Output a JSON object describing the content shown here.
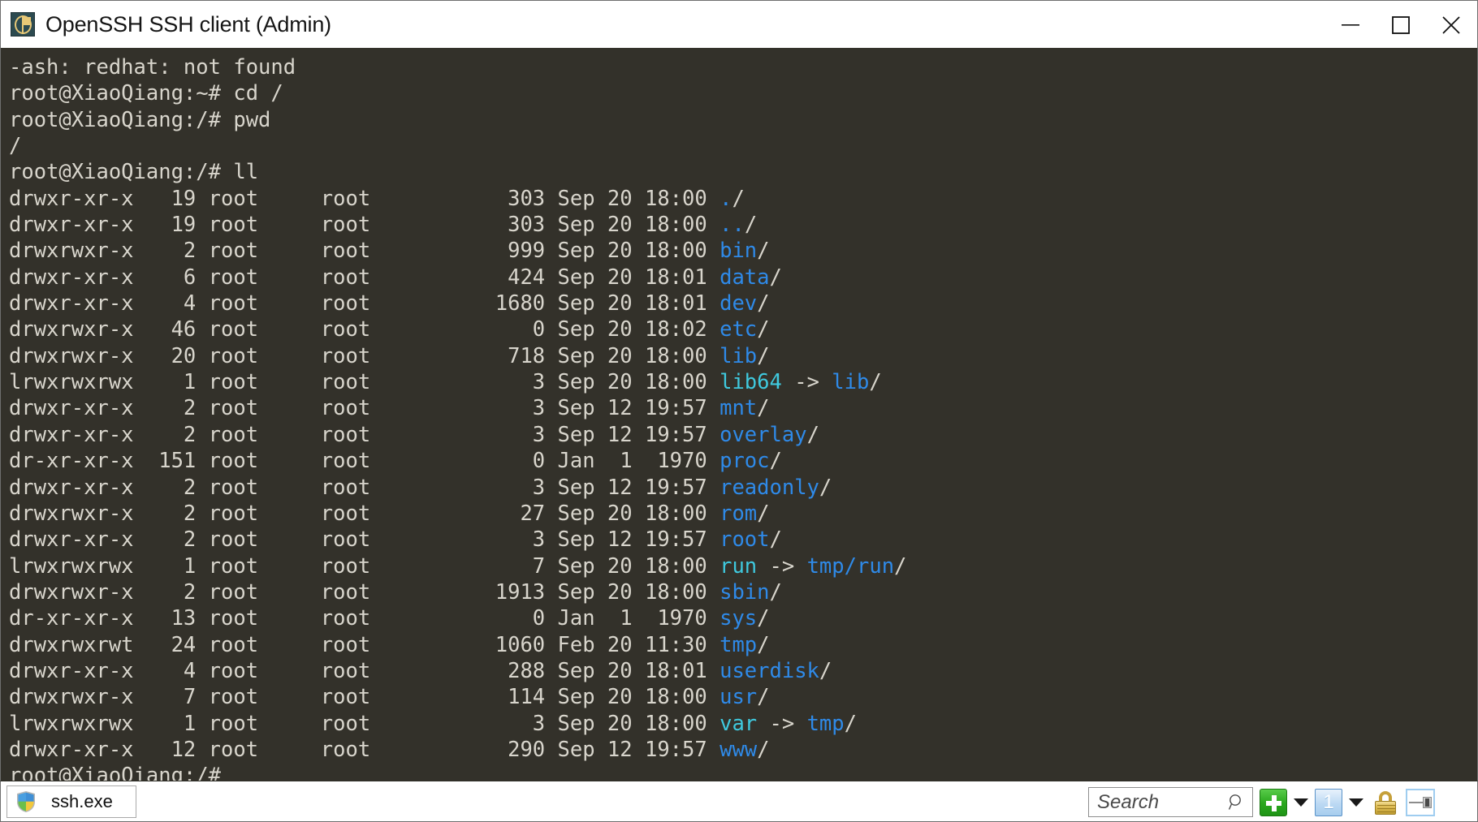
{
  "window": {
    "title": "OpenSSH SSH client (Admin)",
    "icon": "openssh-app-icon",
    "controls": {
      "minimize": "minimize-button",
      "maximize": "maximize-button",
      "close": "close-button"
    }
  },
  "terminal": {
    "background_color": "#33312a",
    "foreground_color": "#d8d5cc",
    "dir_color": "#2f8ae8",
    "link_color": "#3fc9de",
    "lines": [
      {
        "id": "l0",
        "segments": [
          {
            "t": "-ash: redhat: not found",
            "c": "def"
          }
        ]
      },
      {
        "id": "l1",
        "segments": [
          {
            "t": "root@XiaoQiang:~# cd /",
            "c": "def"
          }
        ]
      },
      {
        "id": "l2",
        "segments": [
          {
            "t": "root@XiaoQiang:/# pwd",
            "c": "def"
          }
        ]
      },
      {
        "id": "l3",
        "segments": [
          {
            "t": "/",
            "c": "def"
          }
        ]
      },
      {
        "id": "l4",
        "segments": [
          {
            "t": "root@XiaoQiang:/# ll",
            "c": "def"
          }
        ]
      },
      {
        "id": "l5",
        "segments": [
          {
            "t": "drwxr-xr-x   19 root     root           303 Sep 20 18:00 ",
            "c": "def"
          },
          {
            "t": ".",
            "c": "dir"
          },
          {
            "t": "/",
            "c": "def"
          }
        ]
      },
      {
        "id": "l6",
        "segments": [
          {
            "t": "drwxr-xr-x   19 root     root           303 Sep 20 18:00 ",
            "c": "def"
          },
          {
            "t": "..",
            "c": "dir"
          },
          {
            "t": "/",
            "c": "def"
          }
        ]
      },
      {
        "id": "l7",
        "segments": [
          {
            "t": "drwxrwxr-x    2 root     root           999 Sep 20 18:00 ",
            "c": "def"
          },
          {
            "t": "bin",
            "c": "dir"
          },
          {
            "t": "/",
            "c": "def"
          }
        ]
      },
      {
        "id": "l8",
        "segments": [
          {
            "t": "drwxr-xr-x    6 root     root           424 Sep 20 18:01 ",
            "c": "def"
          },
          {
            "t": "data",
            "c": "dir"
          },
          {
            "t": "/",
            "c": "def"
          }
        ]
      },
      {
        "id": "l9",
        "segments": [
          {
            "t": "drwxr-xr-x    4 root     root          1680 Sep 20 18:01 ",
            "c": "def"
          },
          {
            "t": "dev",
            "c": "dir"
          },
          {
            "t": "/",
            "c": "def"
          }
        ]
      },
      {
        "id": "l10",
        "segments": [
          {
            "t": "drwxrwxr-x   46 root     root             0 Sep 20 18:02 ",
            "c": "def"
          },
          {
            "t": "etc",
            "c": "dir"
          },
          {
            "t": "/",
            "c": "def"
          }
        ]
      },
      {
        "id": "l11",
        "segments": [
          {
            "t": "drwxrwxr-x   20 root     root           718 Sep 20 18:00 ",
            "c": "def"
          },
          {
            "t": "lib",
            "c": "dir"
          },
          {
            "t": "/",
            "c": "def"
          }
        ]
      },
      {
        "id": "l12",
        "segments": [
          {
            "t": "lrwxrwxrwx    1 root     root             3 Sep 20 18:00 ",
            "c": "def"
          },
          {
            "t": "lib64",
            "c": "link"
          },
          {
            "t": " -> ",
            "c": "def"
          },
          {
            "t": "lib",
            "c": "dir"
          },
          {
            "t": "/",
            "c": "def"
          }
        ]
      },
      {
        "id": "l13",
        "segments": [
          {
            "t": "drwxr-xr-x    2 root     root             3 Sep 12 19:57 ",
            "c": "def"
          },
          {
            "t": "mnt",
            "c": "dir"
          },
          {
            "t": "/",
            "c": "def"
          }
        ]
      },
      {
        "id": "l14",
        "segments": [
          {
            "t": "drwxr-xr-x    2 root     root             3 Sep 12 19:57 ",
            "c": "def"
          },
          {
            "t": "overlay",
            "c": "dir"
          },
          {
            "t": "/",
            "c": "def"
          }
        ]
      },
      {
        "id": "l15",
        "segments": [
          {
            "t": "dr-xr-xr-x  151 root     root             0 Jan  1  1970 ",
            "c": "def"
          },
          {
            "t": "proc",
            "c": "dir"
          },
          {
            "t": "/",
            "c": "def"
          }
        ]
      },
      {
        "id": "l16",
        "segments": [
          {
            "t": "drwxr-xr-x    2 root     root             3 Sep 12 19:57 ",
            "c": "def"
          },
          {
            "t": "readonly",
            "c": "dir"
          },
          {
            "t": "/",
            "c": "def"
          }
        ]
      },
      {
        "id": "l17",
        "segments": [
          {
            "t": "drwxrwxr-x    2 root     root            27 Sep 20 18:00 ",
            "c": "def"
          },
          {
            "t": "rom",
            "c": "dir"
          },
          {
            "t": "/",
            "c": "def"
          }
        ]
      },
      {
        "id": "l18",
        "segments": [
          {
            "t": "drwxr-xr-x    2 root     root             3 Sep 12 19:57 ",
            "c": "def"
          },
          {
            "t": "root",
            "c": "dir"
          },
          {
            "t": "/",
            "c": "def"
          }
        ]
      },
      {
        "id": "l19",
        "segments": [
          {
            "t": "lrwxrwxrwx    1 root     root             7 Sep 20 18:00 ",
            "c": "def"
          },
          {
            "t": "run",
            "c": "link"
          },
          {
            "t": " -> ",
            "c": "def"
          },
          {
            "t": "tmp/run",
            "c": "dir"
          },
          {
            "t": "/",
            "c": "def"
          }
        ]
      },
      {
        "id": "l20",
        "segments": [
          {
            "t": "drwxrwxr-x    2 root     root          1913 Sep 20 18:00 ",
            "c": "def"
          },
          {
            "t": "sbin",
            "c": "dir"
          },
          {
            "t": "/",
            "c": "def"
          }
        ]
      },
      {
        "id": "l21",
        "segments": [
          {
            "t": "dr-xr-xr-x   13 root     root             0 Jan  1  1970 ",
            "c": "def"
          },
          {
            "t": "sys",
            "c": "dir"
          },
          {
            "t": "/",
            "c": "def"
          }
        ]
      },
      {
        "id": "l22",
        "segments": [
          {
            "t": "drwxrwxrwt   24 root     root          1060 Feb 20 11:30 ",
            "c": "def"
          },
          {
            "t": "tmp",
            "c": "dir"
          },
          {
            "t": "/",
            "c": "def"
          }
        ]
      },
      {
        "id": "l23",
        "segments": [
          {
            "t": "drwxr-xr-x    4 root     root           288 Sep 20 18:01 ",
            "c": "def"
          },
          {
            "t": "userdisk",
            "c": "dir"
          },
          {
            "t": "/",
            "c": "def"
          }
        ]
      },
      {
        "id": "l24",
        "segments": [
          {
            "t": "drwxrwxr-x    7 root     root           114 Sep 20 18:00 ",
            "c": "def"
          },
          {
            "t": "usr",
            "c": "dir"
          },
          {
            "t": "/",
            "c": "def"
          }
        ]
      },
      {
        "id": "l25",
        "segments": [
          {
            "t": "lrwxrwxrwx    1 root     root             3 Sep 20 18:00 ",
            "c": "def"
          },
          {
            "t": "var",
            "c": "link"
          },
          {
            "t": " -> ",
            "c": "def"
          },
          {
            "t": "tmp",
            "c": "dir"
          },
          {
            "t": "/",
            "c": "def"
          }
        ]
      },
      {
        "id": "l26",
        "segments": [
          {
            "t": "drwxr-xr-x   12 root     root           290 Sep 12 19:57 ",
            "c": "def"
          },
          {
            "t": "www",
            "c": "dir"
          },
          {
            "t": "/",
            "c": "def"
          }
        ]
      },
      {
        "id": "l27",
        "segments": [
          {
            "t": "root@XiaoQiang:/#",
            "c": "def"
          }
        ]
      }
    ]
  },
  "taskbar": {
    "task_button": {
      "label": "ssh.exe",
      "icon": "uac-shield-icon"
    },
    "search": {
      "placeholder": "Search",
      "value": "",
      "icon": "search-icon"
    },
    "tray": {
      "new_tab_button": "plus-icon",
      "new_tab_dropdown": "chevron-down-icon",
      "session_button_label": "1",
      "session_dropdown": "chevron-down-icon",
      "lock_icon": "padlock-icon",
      "panel_layout_icon": "panel-layout-icon",
      "menu_icon": "hamburger-menu-icon"
    }
  }
}
